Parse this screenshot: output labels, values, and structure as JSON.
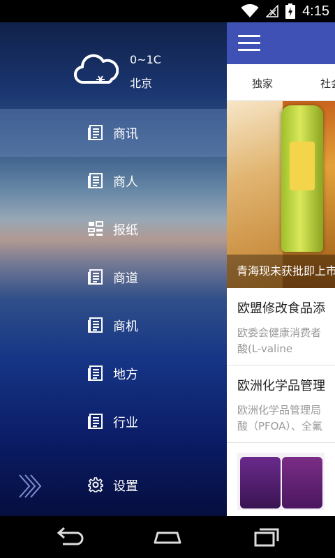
{
  "status_bar": {
    "time": "4:15"
  },
  "drawer": {
    "weather": {
      "temperature": "0~1C",
      "city": "北京",
      "icon": "snow-cloud-icon"
    },
    "menu_items": [
      {
        "label": "商讯",
        "icon": "newspaper-icon",
        "active": true
      },
      {
        "label": "商人",
        "icon": "newspaper-icon"
      },
      {
        "label": "报纸",
        "icon": "grid-icon"
      },
      {
        "label": "商道",
        "icon": "newspaper-icon"
      },
      {
        "label": "商机",
        "icon": "newspaper-icon"
      },
      {
        "label": "地方",
        "icon": "newspaper-icon"
      },
      {
        "label": "行业",
        "icon": "newspaper-icon"
      }
    ],
    "settings_label": "设置"
  },
  "content": {
    "tabs": [
      "独家",
      "社会"
    ],
    "hero_caption": "青海现未获批即上市",
    "articles": [
      {
        "title": "欧盟修改食品添",
        "summary_line1": "欧委会健康消费者",
        "summary_line2": "酸(L-valine"
      },
      {
        "title": "欧洲化学品管理",
        "summary_line1": "欧洲化学品管理局",
        "summary_line2": "酸（PFOA）、全氟"
      }
    ]
  },
  "colors": {
    "app_bar": "#3f51b5",
    "drawer_active": "#7896c8"
  }
}
